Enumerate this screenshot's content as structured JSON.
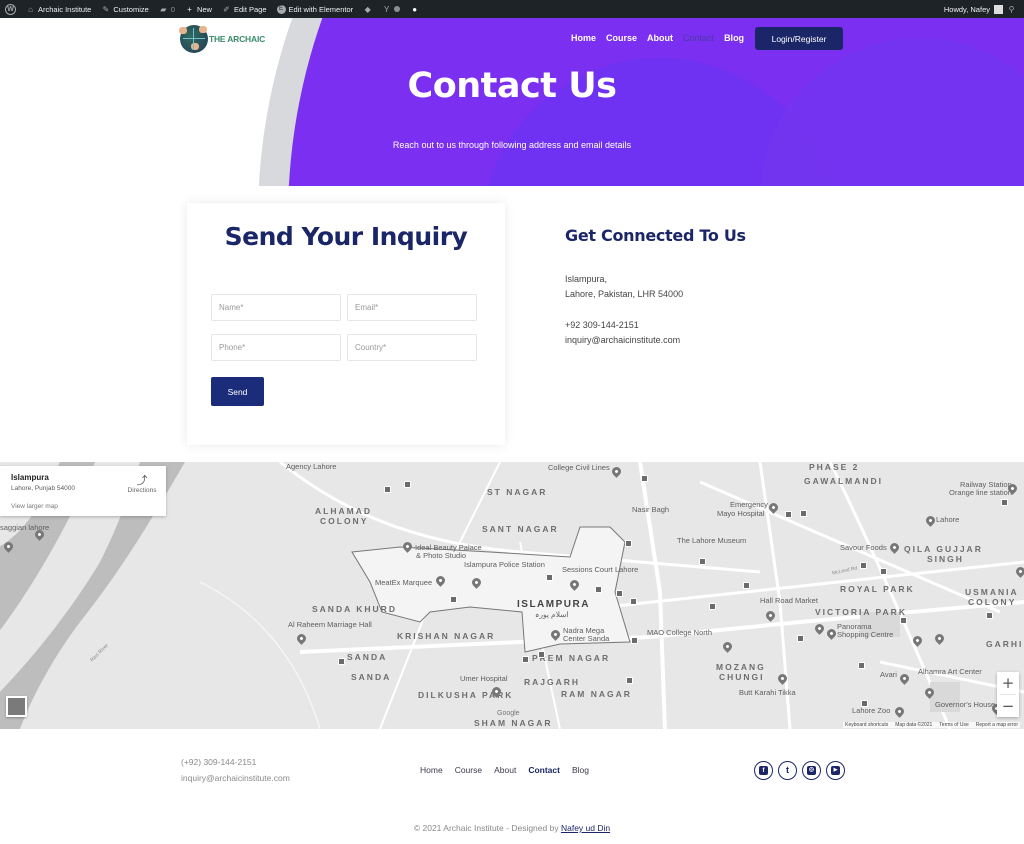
{
  "admin_bar": {
    "site_name": "Archaic Institute",
    "customize": "Customize",
    "comments_count": "0",
    "new": "New",
    "edit_page": "Edit Page",
    "edit_with_elementor": "Edit with Elementor",
    "greeting": "Howdy, Nafey"
  },
  "header": {
    "logo_text": "THE ARCHAIC",
    "nav": [
      {
        "label": "Home",
        "active": false
      },
      {
        "label": "Course",
        "active": false
      },
      {
        "label": "About",
        "active": false
      },
      {
        "label": "Contact",
        "active": true
      },
      {
        "label": "Blog",
        "active": false
      }
    ],
    "login_label": "Login/Register"
  },
  "hero": {
    "title": "Contact Us",
    "subtitle": "Reach out to us through following address and email details"
  },
  "inquiry_form": {
    "title": "Send Your Inquiry",
    "fields": {
      "name_placeholder": "Name*",
      "email_placeholder": "Email*",
      "phone_placeholder": "Phone*",
      "country_placeholder": "Country*"
    },
    "send_label": "Send"
  },
  "contact_info": {
    "title": "Get Connected To Us",
    "address_line1": "Islampura,",
    "address_line2": "Lahore, Pakistan, LHR 54000",
    "phone": "+92 309-144-2151",
    "email": "inquiry@archaicinstitute.com"
  },
  "map": {
    "place_title": "Islampura",
    "place_address": "Lahore, Punjab 54000",
    "view_larger": "View larger map",
    "directions": "Directions",
    "labels": {
      "agency": "Agency Lahore",
      "saggian": "saggian lahore",
      "alhamad1": "ALHAMAD",
      "alhamad2": "COLONY",
      "college": "College Civil Lines",
      "st_nagar": "ST NAGAR",
      "phase2": "PHASE 2",
      "gawalmandi": "GAWALMANDI",
      "railway1": "Railway Station",
      "railway2": "Orange line station",
      "emergency1": "Emergency",
      "emergency2": "Mayo Hospital",
      "nasir_bagh": "Nasir Bagh",
      "lahore_pin": "Lahore",
      "museum": "The Lahore Museum",
      "sant_nagar": "SANT NAGAR",
      "ideal1": "Ideal Beauty Palace",
      "ideal2": "& Photo Studio",
      "savour": "Savour Foods",
      "qila1": "QILA GUJJAR",
      "qila2": "SINGH",
      "police": "Islampura Police Station",
      "sessions": "Sessions Court Lahore",
      "meatex": "MeatEx Marquee",
      "royal_park": "ROYAL PARK",
      "usmania1": "USMANIA",
      "usmania2": "COLONY",
      "sanda_khurd": "SANDA KHURD",
      "islampura": "ISLAMPURA",
      "islampura_ur": "اسلام پورہ",
      "hall_road": "Hall Road Market",
      "victoria_park": "VICTORIA PARK",
      "al_raheem": "Al Raheem Marriage Hall",
      "krishan_nagar": "KRISHAN NAGAR",
      "nadra1": "Nadra Mega",
      "nadra2": "Center Sanda",
      "mao": "MAO College North",
      "panorama1": "Panorama",
      "panorama2": "Shopping Centre",
      "garhi": "GARHI",
      "ravi_river": "Ravi River",
      "sanda1": "SANDA",
      "prem_nagar": "PREM NAGAR",
      "mozang1": "MOZANG",
      "mozang2": "CHUNGI",
      "alhamra": "Alhamra Art Center",
      "sanda2": "SANDA",
      "umer": "Umer Hospital",
      "rajgarh": "RAJGARH",
      "avari": "Avari",
      "dilkusha": "DILKUSHA PARK",
      "ram_nagar": "RAM NAGAR",
      "butt": "Butt Karahi Tikka",
      "governor": "Governor's House",
      "sham_nagar": "SHAM NAGAR",
      "lahore_zoo": "Lahore Zoo",
      "mcleod": "McLeod Rd",
      "google": "Google"
    },
    "attribution": [
      "Keyboard shortcuts",
      "Map data ©2021",
      "Terms of Use",
      "Report a map error"
    ],
    "zoom_in": "+",
    "zoom_out": "−"
  },
  "footer": {
    "phone": "(+92) 309-144-2151",
    "email": "inquiry@archaicinstitute.com",
    "nav": [
      {
        "label": "Home",
        "active": false
      },
      {
        "label": "Course",
        "active": false
      },
      {
        "label": "About",
        "active": false
      },
      {
        "label": "Contact",
        "active": true
      },
      {
        "label": "Blog",
        "active": false
      }
    ],
    "socials": [
      {
        "name": "facebook",
        "glyph": "f"
      },
      {
        "name": "twitter",
        "glyph": "t"
      },
      {
        "name": "instagram",
        "glyph": "◎"
      },
      {
        "name": "youtube",
        "glyph": "▶"
      }
    ],
    "copyright_prefix": "© 2021 Archaic Institute - Designed by",
    "designer": "Nafey ud Din"
  },
  "colors": {
    "brand_navy": "#1b2668",
    "hero_purple": "#7b2ff0",
    "admin_bar": "#1d2327"
  }
}
